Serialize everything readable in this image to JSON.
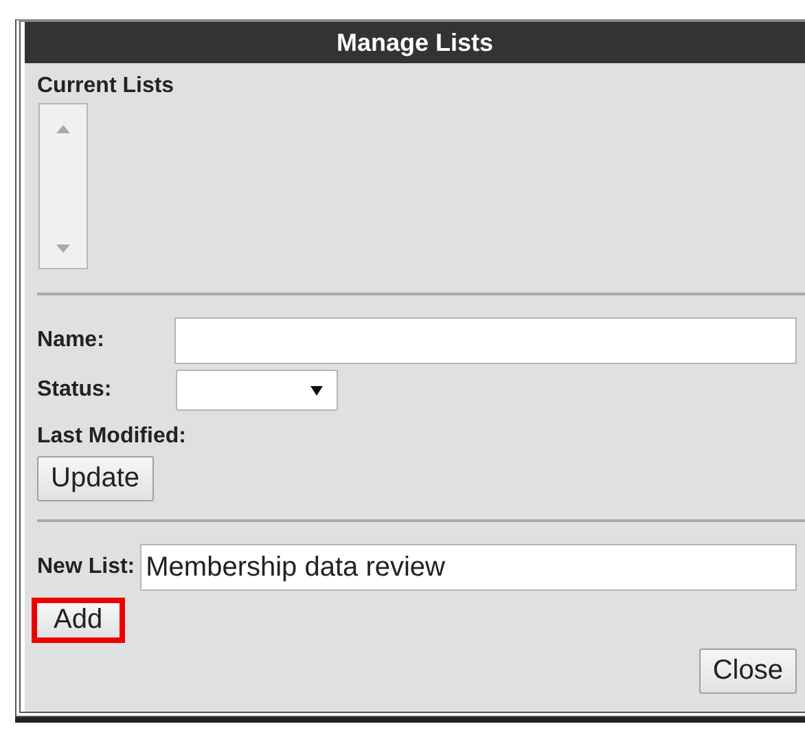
{
  "window": {
    "title": "Manage Lists"
  },
  "current_lists": {
    "label": "Current Lists"
  },
  "name": {
    "label": "Name:"
  },
  "status": {
    "label": "Status:"
  },
  "last_modified": {
    "label": "Last Modified:"
  },
  "update_button": {
    "label": "Update",
    "highlighted": false
  },
  "new_list": {
    "label": "New List:",
    "value": "Membership data review"
  },
  "add_button": {
    "label": "Add",
    "highlighted": true
  },
  "close_button": {
    "label": "Close",
    "highlighted": false
  }
}
